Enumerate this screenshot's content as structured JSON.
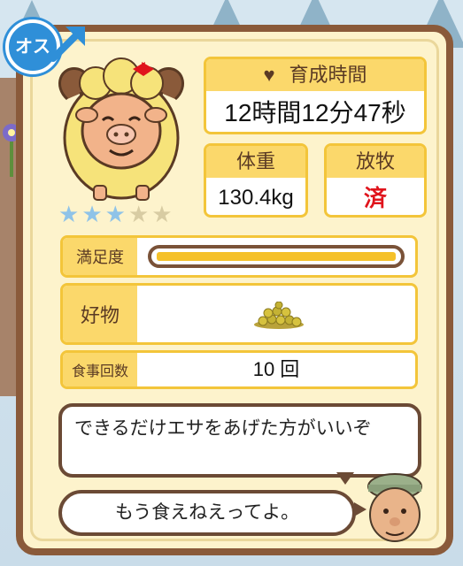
{
  "gender": {
    "label": "オス",
    "icon": "male-symbol-icon"
  },
  "animal": {
    "icon": "sheep-portrait-icon",
    "stars_filled": 3,
    "stars_total": 5
  },
  "growth_time": {
    "label": "育成時間",
    "value": "12時間12分47秒"
  },
  "weight": {
    "label": "体重",
    "value": "130.4kg"
  },
  "grazing": {
    "label": "放牧",
    "value": "済"
  },
  "satisfaction": {
    "label": "満足度",
    "level_fraction": 1.0
  },
  "favorite": {
    "label": "好物",
    "item_icon": "grain-pile-icon"
  },
  "meals": {
    "label": "食事回数",
    "value": "10 回"
  },
  "dialog": {
    "message_1": "できるだけエサをあげた方がいいぞ",
    "message_2": "もう食えねえってよ。",
    "speaker_icon": "farmer-face-icon"
  },
  "colors": {
    "header_yellow": "#fbd86b",
    "frame_brown": "#8a5a3a",
    "done_red": "#e0141c",
    "gender_blue": "#2f8fd8"
  }
}
